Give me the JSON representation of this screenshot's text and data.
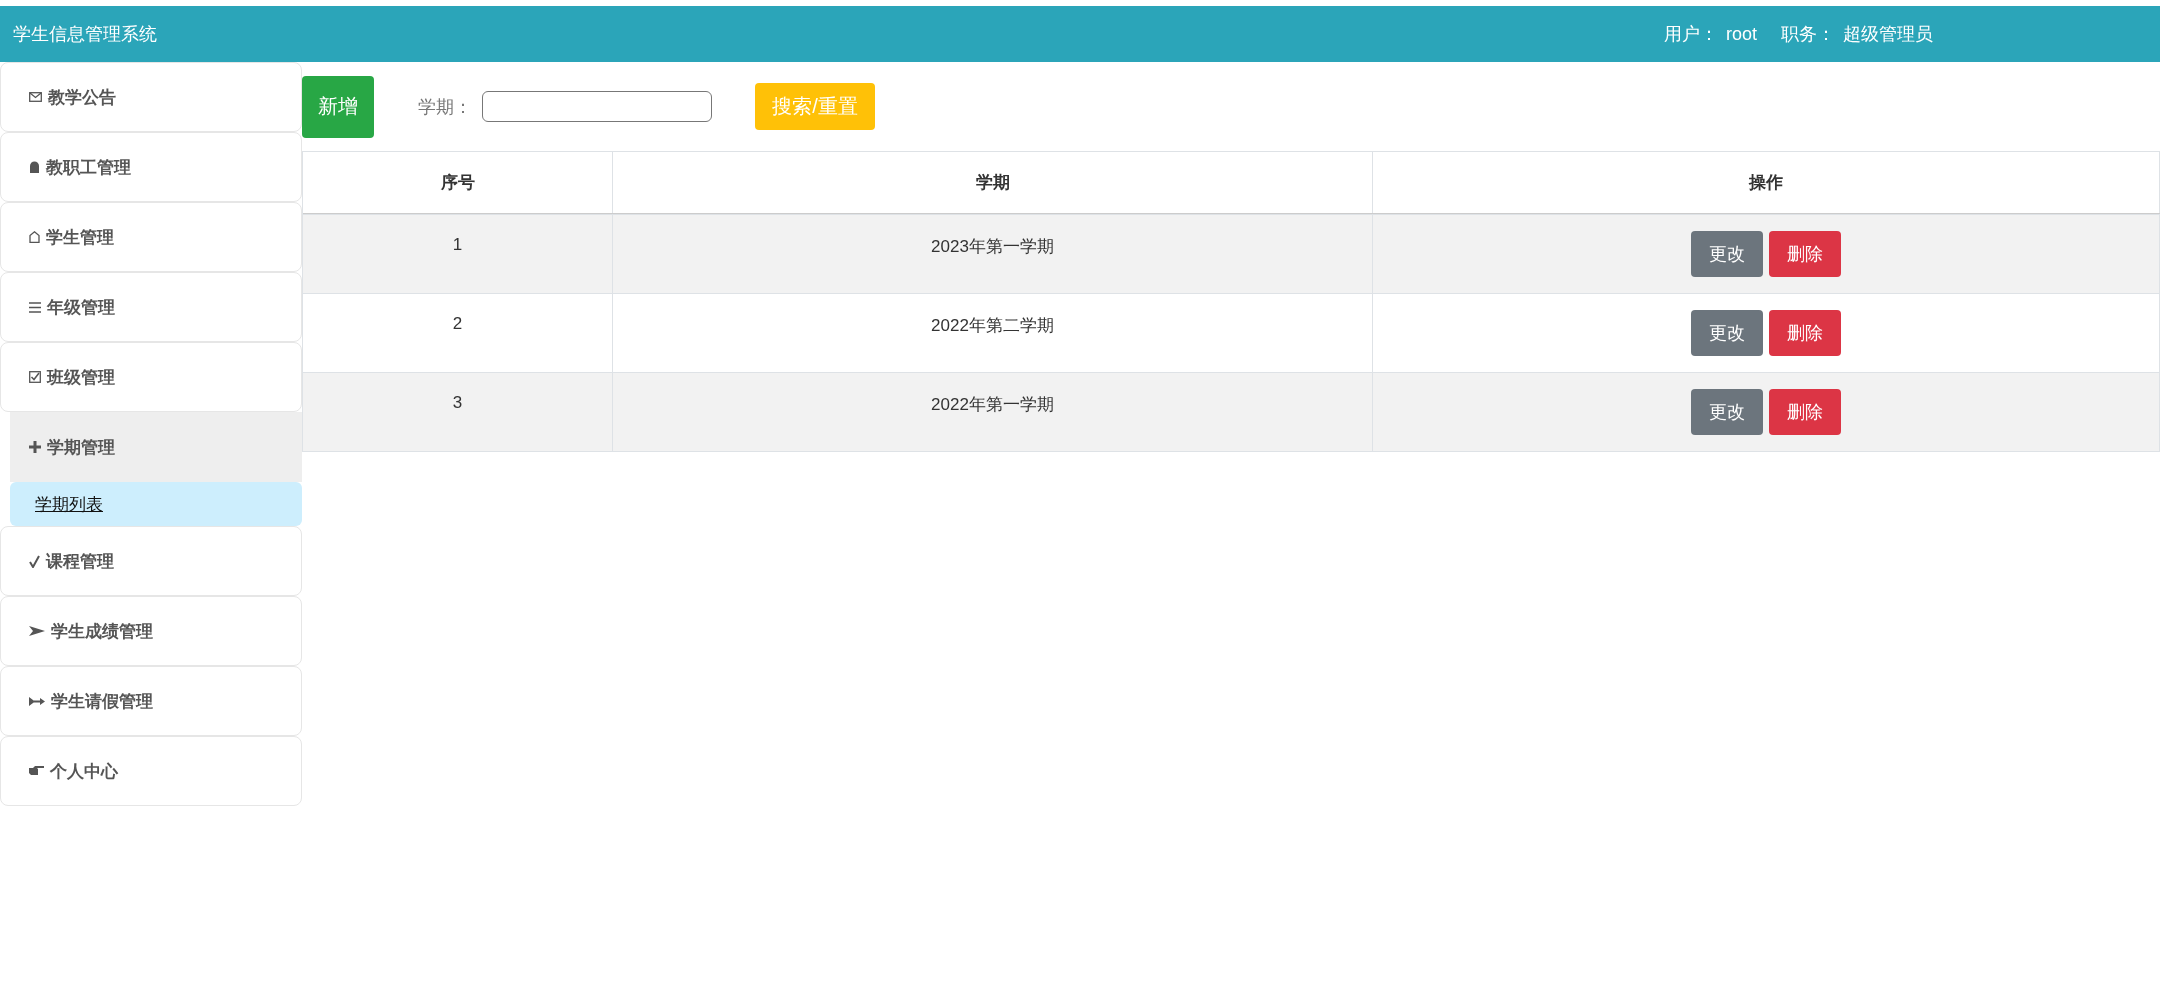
{
  "header": {
    "title": "学生信息管理系统",
    "user_label": "用户：",
    "user": "root",
    "role_label": "职务：",
    "role": "超级管理员"
  },
  "sidebar": {
    "items": [
      {
        "label": "教学公告",
        "expanded": false
      },
      {
        "label": "教职工管理",
        "expanded": false
      },
      {
        "label": "学生管理",
        "expanded": false
      },
      {
        "label": "年级管理",
        "expanded": false
      },
      {
        "label": "班级管理",
        "expanded": false
      },
      {
        "label": "学期管理",
        "expanded": true,
        "children": [
          {
            "label": "学期列表",
            "selected": true
          }
        ]
      },
      {
        "label": "课程管理",
        "expanded": false
      },
      {
        "label": "学生成绩管理",
        "expanded": false
      },
      {
        "label": "学生请假管理",
        "expanded": false
      },
      {
        "label": "个人中心",
        "expanded": false
      }
    ]
  },
  "toolbar": {
    "add_button": "新增",
    "filter_label": "学期：",
    "search_button": "搜索/重置"
  },
  "table": {
    "columns": [
      "序号",
      "学期",
      "操作"
    ],
    "rows": [
      {
        "index": "1",
        "term": "2023年第一学期",
        "edit": "更改",
        "delete": "删除"
      },
      {
        "index": "2",
        "term": "2022年第二学期",
        "edit": "更改",
        "delete": "删除"
      },
      {
        "index": "3",
        "term": "2022年第一学期",
        "edit": "更改",
        "delete": "删除"
      }
    ]
  }
}
